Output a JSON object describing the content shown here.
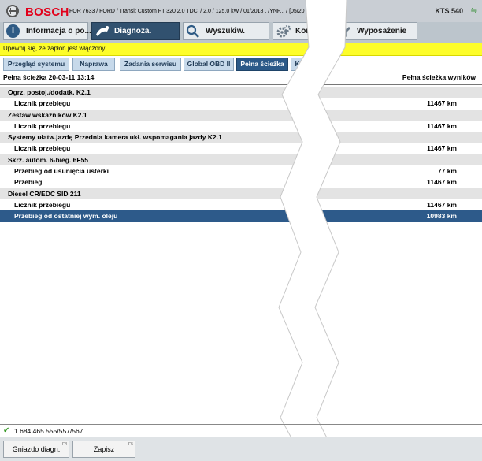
{
  "titlebar": {
    "brand": "BOSCH",
    "vehicle": "FOR 7633 / FORD / Transit Custom FT 320 2.0 TDCi / 2.0 / 125.0 kW / 01/2018 . /YNF... / [05/20",
    "device": "KTS 540"
  },
  "main_tabs": [
    {
      "label": "Informacja o po...",
      "icon": "info-icon"
    },
    {
      "label": "Diagnoza.",
      "icon": "stethoscope-icon"
    },
    {
      "label": "Wyszukiw.",
      "icon": "search-icon"
    },
    {
      "label": "Kon",
      "icon": "gear-icon"
    },
    {
      "label": "Wyposażenie",
      "icon": "edit-icon"
    }
  ],
  "notice": "Upewnij się, że zapłon jest włączony.",
  "sub_tabs": [
    {
      "label": "Przegląd systemu"
    },
    {
      "label": "Naprawa"
    },
    {
      "label": "Zadania serwisu"
    },
    {
      "label": "Global OBD II"
    },
    {
      "label": "Pełna ścieżka"
    },
    {
      "label": "Kom"
    }
  ],
  "heading": {
    "left": "Pełna ścieżka  20-03-11  13:14",
    "right": "Pełna ścieżka wyników"
  },
  "rows": [
    {
      "type": "group",
      "label": "Ogrz. postoj./dodatk. K2.1",
      "value": ""
    },
    {
      "type": "item",
      "label": "Licznik przebiegu",
      "value": "11467 km"
    },
    {
      "type": "group",
      "label": "Zestaw wskaźników K2.1",
      "value": ""
    },
    {
      "type": "item",
      "label": "Licznik przebiegu",
      "value": "11467 km"
    },
    {
      "type": "group",
      "label": "Systemy ułatw.jazdę Przednia kamera ukł. wspomagania jazdy K2.1",
      "value": ""
    },
    {
      "type": "item",
      "label": "Licznik przebiegu",
      "value": "11467 km"
    },
    {
      "type": "group",
      "label": "Skrz. autom. 6-bieg. 6F55",
      "value": ""
    },
    {
      "type": "item",
      "label": "Przebieg od usunięcia usterki",
      "value": "77 km"
    },
    {
      "type": "item",
      "label": "Przebieg",
      "value": "11467 km"
    },
    {
      "type": "group",
      "label": "Diesel CR/EDC SID 211",
      "value": ""
    },
    {
      "type": "item",
      "label": "Licznik przebiegu",
      "value": "11467 km"
    },
    {
      "type": "item",
      "label": "Przebieg od ostatniej wym. oleju",
      "value": "10983 km",
      "selected": true
    }
  ],
  "status": {
    "check": "✔",
    "text": "1 684 465 555/557/567"
  },
  "footer": {
    "buttons": [
      {
        "label": "Gniazdo diagn.",
        "key": "F4"
      },
      {
        "label": "Zapisz",
        "key": "F5"
      }
    ]
  },
  "colors": {
    "accent": "#2d5a8a",
    "notice": "#fdfd2a",
    "brand": "#e2001a"
  }
}
